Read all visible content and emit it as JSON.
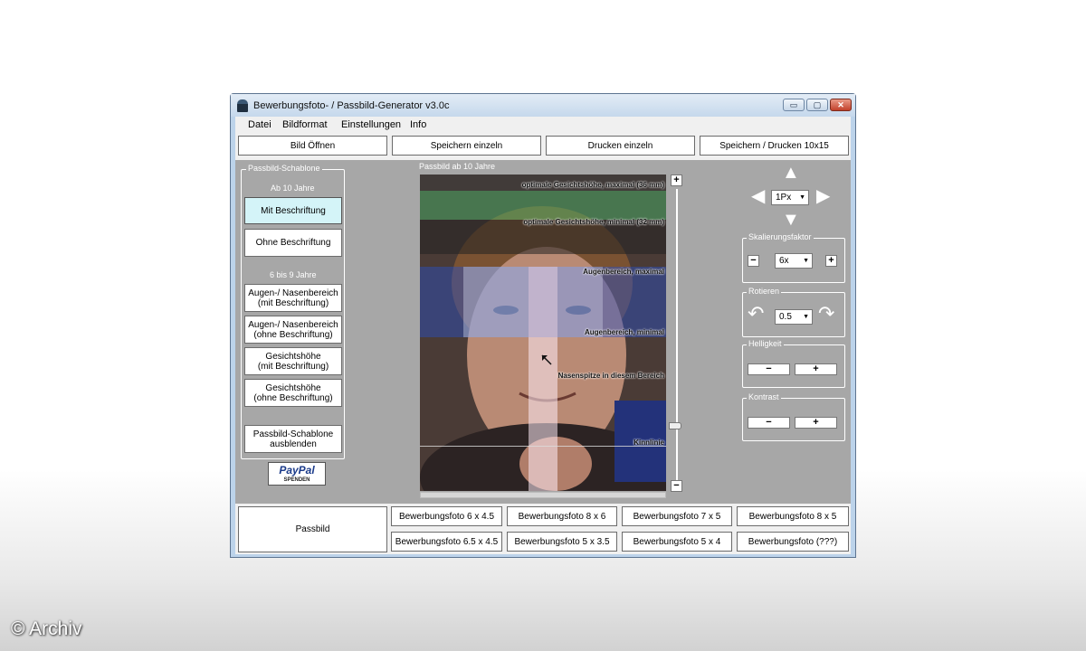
{
  "window": {
    "title": "Bewerbungsfoto- /  Passbild-Generator v3.0c",
    "controls": {
      "minimize": "▭",
      "maximize": "▢",
      "close": "✕"
    }
  },
  "menu": [
    "Datei",
    "Bildformat",
    "Einstellungen",
    "Info"
  ],
  "toolbar": [
    "Bild Öffnen",
    "Speichern einzeln",
    "Drucken einzeln",
    "Speichern / Drucken 10x15"
  ],
  "template_panel": {
    "group_label": "Passbild-Schablone",
    "section1": "Ab 10 Jahre",
    "btn_mit": "Mit Beschriftung",
    "btn_ohne": "Ohne Beschriftung",
    "section2": "6 bis 9 Jahre",
    "btn_augen_mit_1": "Augen-/ Nasenbereich",
    "btn_augen_mit_2": "(mit Beschriftung)",
    "btn_augen_ohne_1": "Augen-/ Nasenbereich",
    "btn_augen_ohne_2": "(ohne Beschriftung)",
    "btn_gesicht_mit_1": "Gesichtshöhe",
    "btn_gesicht_mit_2": "(mit Beschriftung)",
    "btn_gesicht_ohne_1": "Gesichtshöhe",
    "btn_gesicht_ohne_2": "(ohne Beschriftung)",
    "btn_hide_1": "Passbild-Schablone",
    "btn_hide_2": "ausblenden"
  },
  "paypal": {
    "logo": "PayPal",
    "sub": "SPENDEN"
  },
  "photo": {
    "caption": "Passbild ab 10 Jahre",
    "label_max": "optimale Gesichtshöhe, maximal (36 mm)",
    "label_min": "optimale Gesichtshöhe, minimal (32 mm)",
    "label_eye_max": "Augenbereich, maximal",
    "label_eye_min": "Augenbereich, minimal",
    "label_nose": "Nasenspitze in diesem Bereich",
    "label_chin": "Kinnlinie",
    "zoom_plus": "+",
    "zoom_minus": "−"
  },
  "controls": {
    "step_value": "1Px",
    "scale_label": "Skalierungsfaktor",
    "scale_value": "6x",
    "rotate_label": "Rotieren",
    "rotate_value": "0.5",
    "brightness_label": "Helligkeit",
    "contrast_label": "Kontrast",
    "minus": "−",
    "plus": "+"
  },
  "formats": {
    "passbild": "Passbild",
    "row1": [
      "Bewerbungsfoto 6 x 4.5",
      "Bewerbungsfoto 8 x 6",
      "Bewerbungsfoto 7 x 5",
      "Bewerbungsfoto 8 x 5"
    ],
    "row2": [
      "Bewerbungsfoto 6.5 x 4.5",
      "Bewerbungsfoto 5 x 3.5",
      "Bewerbungsfoto 5 x 4",
      "Bewerbungsfoto (???)"
    ]
  },
  "watermark": "© Archiv",
  "colors": {
    "selected_button": "#d4f4f8",
    "panel_grey": "#a7a7a7"
  }
}
